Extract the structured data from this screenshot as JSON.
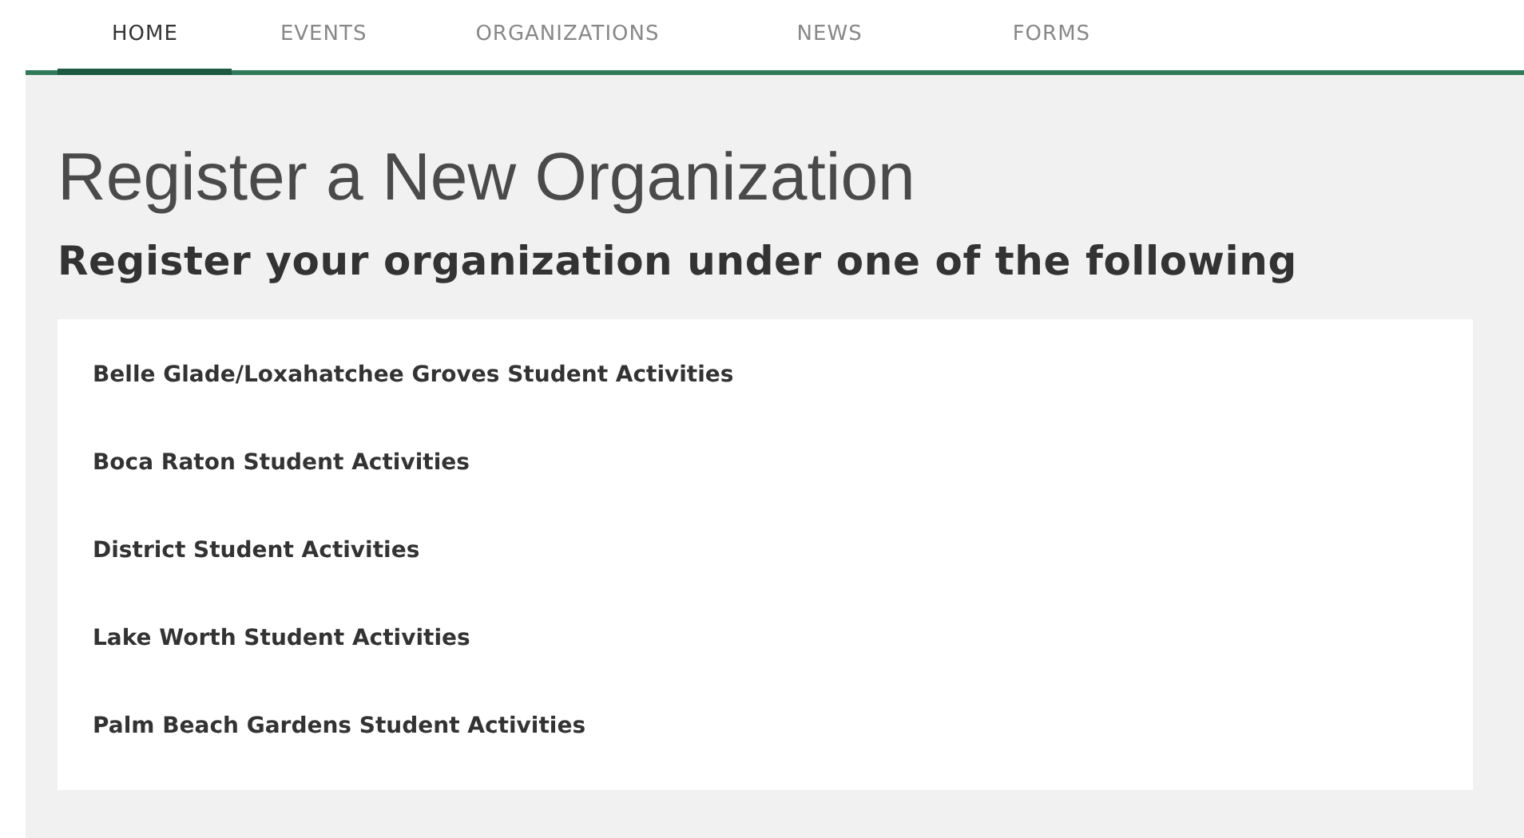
{
  "nav": {
    "tabs": [
      {
        "label": "HOME",
        "selected": true
      },
      {
        "label": "EVENTS",
        "selected": false
      },
      {
        "label": "ORGANIZATIONS",
        "selected": false
      },
      {
        "label": "NEWS",
        "selected": false
      },
      {
        "label": "FORMS",
        "selected": false
      }
    ]
  },
  "title": "Register a New Organization",
  "subtitle": "Register your organization under one of the following",
  "options": [
    {
      "label": "Belle Glade/Loxahatchee Groves Student Activities"
    },
    {
      "label": "Boca Raton Student Activities"
    },
    {
      "label": "District Student Activities"
    },
    {
      "label": "Lake Worth Student Activities"
    },
    {
      "label": "Palm Beach Gardens Student Activities"
    }
  ]
}
